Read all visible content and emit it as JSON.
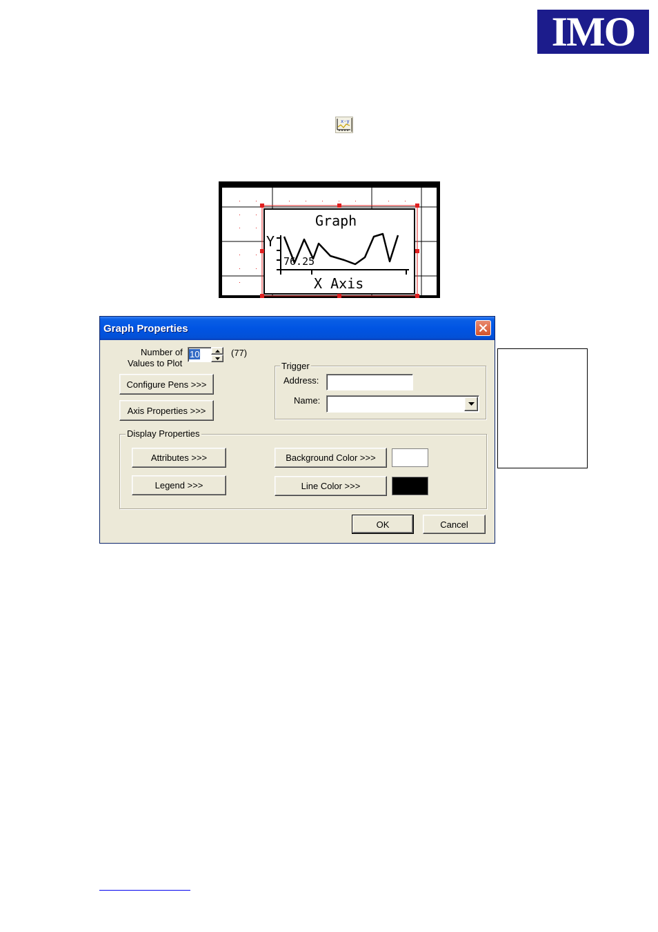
{
  "logo": {
    "text": "IMO",
    "color": "#1c1c8c"
  },
  "toolbar_icon": {
    "name": "xy-graph-icon",
    "label": "x-y"
  },
  "preview": {
    "title": "Graph",
    "y_label": "Y",
    "value_label": "76.25",
    "x_label": "X Axis"
  },
  "dialog": {
    "title": "Graph Properties",
    "num_values_label_1": "Number of",
    "num_values_label_2": "Values to Plot",
    "num_values": "10",
    "num_values_max": "(77)",
    "configure_pens": "Configure Pens >>>",
    "axis_properties": "Axis Properties >>>",
    "trigger": {
      "group_label": "Trigger",
      "address_label": "Address:",
      "address_value": "",
      "name_label": "Name:",
      "name_value": ""
    },
    "display": {
      "group_label": "Display Properties",
      "attributes": "Attributes >>>",
      "legend": "Legend >>>",
      "background_color_btn": "Background Color >>>",
      "line_color_btn": "Line Color >>>",
      "background_color": "#ffffff",
      "line_color": "#000000"
    },
    "ok": "OK",
    "cancel": "Cancel"
  }
}
